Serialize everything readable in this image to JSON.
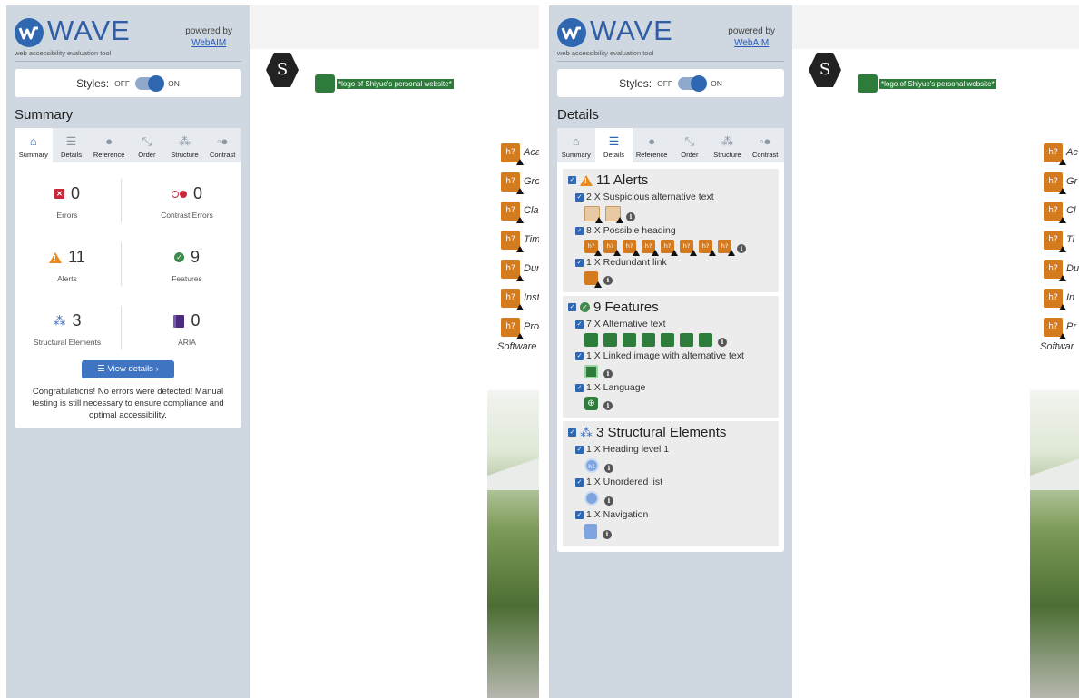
{
  "wave": {
    "logo_text": "WAVE",
    "tagline": "web accessibility evaluation tool",
    "powered_by": "powered by",
    "powered_link": "WebAIM",
    "styles_label": "Styles:",
    "off": "OFF",
    "on": "ON"
  },
  "tabs": [
    {
      "label": "Summary",
      "icon": "home-icon",
      "glyph": "⌂"
    },
    {
      "label": "Details",
      "icon": "list-icon",
      "glyph": "☰"
    },
    {
      "label": "Reference",
      "icon": "info-icon",
      "glyph": "●"
    },
    {
      "label": "Order",
      "icon": "order-icon",
      "glyph": "⤡"
    },
    {
      "label": "Structure",
      "icon": "structure-icon",
      "glyph": "⁂"
    },
    {
      "label": "Contrast",
      "icon": "contrast-icon",
      "glyph": "◦●"
    }
  ],
  "left": {
    "title": "Summary",
    "active_tab": 0,
    "counts": [
      {
        "value": "0",
        "label": "Errors",
        "icon": "error-icon"
      },
      {
        "value": "0",
        "label": "Contrast Errors",
        "icon": "contrast-error-icon"
      },
      {
        "value": "11",
        "label": "Alerts",
        "icon": "alert-icon"
      },
      {
        "value": "9",
        "label": "Features",
        "icon": "feature-icon"
      },
      {
        "value": "3",
        "label": "Structural Elements",
        "icon": "structure-icon"
      },
      {
        "value": "0",
        "label": "ARIA",
        "icon": "aria-icon"
      }
    ],
    "view_details": "View details ›",
    "congrats": "Congratulations! No errors were detected! Manual testing is still necessary to ensure compliance and optimal accessibility."
  },
  "right": {
    "title": "Details",
    "active_tab": 1,
    "groups": [
      {
        "heading": "11 Alerts",
        "icon": "alert-icon",
        "items": [
          {
            "label": "2 X Suspicious alternative text",
            "icon_type": "suspicious-alt-icon",
            "count": 2
          },
          {
            "label": "8 X Possible heading",
            "icon_type": "possible-heading-icon",
            "count": 8
          },
          {
            "label": "1 X Redundant link",
            "icon_type": "redundant-link-icon",
            "count": 1
          }
        ]
      },
      {
        "heading": "9 Features",
        "icon": "feature-icon",
        "items": [
          {
            "label": "7 X Alternative text",
            "icon_type": "alt-text-icon",
            "count": 7
          },
          {
            "label": "1 X Linked image with alternative text",
            "icon_type": "linked-image-alt-icon",
            "count": 1
          },
          {
            "label": "1 X Language",
            "icon_type": "language-icon",
            "count": 1
          }
        ]
      },
      {
        "heading": "3 Structural Elements",
        "icon": "structure-icon",
        "items": [
          {
            "label": "1 X Heading level 1",
            "icon_type": "heading-level-1-icon",
            "count": 1
          },
          {
            "label": "1 X Unordered list",
            "icon_type": "unordered-list-icon",
            "count": 1
          },
          {
            "label": "1 X Navigation",
            "icon_type": "navigation-icon",
            "count": 1
          }
        ]
      }
    ]
  },
  "site": {
    "logo_glyph": "S",
    "alt_chip": "*logo of Shiyue's personal website*",
    "heading_badge": "h?",
    "nav_left": [
      "Aca",
      "Gro",
      "Cla",
      "Tim",
      "Dur",
      "Inst",
      "Pro"
    ],
    "nav_right": [
      "Ac",
      "Gr",
      "Cl",
      "Ti",
      "Du",
      "In",
      "Pr"
    ],
    "software_left": "Software",
    "software_right": "Softwar"
  },
  "colors": {
    "wave_blue": "#2f67b1",
    "sidebar_bg": "#cfd7e0",
    "error_red": "#c7283b",
    "alert_orange": "#e98a1f",
    "feature_green": "#3f8a4c",
    "aria_purple": "#4b2b7d"
  }
}
